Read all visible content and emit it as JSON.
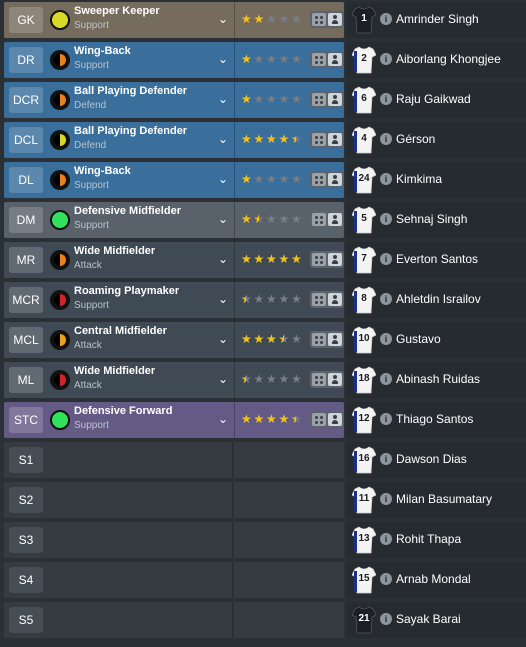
{
  "starters": [
    {
      "pos": "GK",
      "role": "Sweeper Keeper",
      "duty": "Support",
      "style": "gk",
      "duty_colors": [
        "#d6d926",
        "#d6d926"
      ],
      "rating": 2,
      "shirt": "gk",
      "number": "1",
      "player": "Amrinder Singh"
    },
    {
      "pos": "DR",
      "role": "Wing-Back",
      "duty": "Support",
      "style": "def",
      "duty_colors": [
        "#000000",
        "#e8801d"
      ],
      "rating": 1,
      "shirt": "field",
      "number": "2",
      "player": "Aiborlang Khongjee"
    },
    {
      "pos": "DCR",
      "role": "Ball Playing Defender",
      "duty": "Defend",
      "style": "def",
      "duty_colors": [
        "#000000",
        "#e8801d"
      ],
      "rating": 1,
      "shirt": "field",
      "number": "6",
      "player": "Raju Gaikwad"
    },
    {
      "pos": "DCL",
      "role": "Ball Playing Defender",
      "duty": "Defend",
      "style": "def",
      "duty_colors": [
        "#000000",
        "#d6d926"
      ],
      "rating": 4.5,
      "shirt": "field",
      "number": "4",
      "player": "Gérson"
    },
    {
      "pos": "DL",
      "role": "Wing-Back",
      "duty": "Support",
      "style": "def",
      "duty_colors": [
        "#000000",
        "#e8801d"
      ],
      "rating": 1,
      "shirt": "field",
      "number": "24",
      "player": "Kimkima"
    },
    {
      "pos": "DM",
      "role": "Defensive Midfielder",
      "duty": "Support",
      "style": "dm",
      "duty_colors": [
        "#31e25d",
        "#31e25d"
      ],
      "rating": 1.5,
      "shirt": "field",
      "number": "5",
      "player": "Sehnaj Singh"
    },
    {
      "pos": "MR",
      "role": "Wide Midfielder",
      "duty": "Attack",
      "style": "mid",
      "duty_colors": [
        "#000000",
        "#e8801d"
      ],
      "rating": 5,
      "shirt": "field",
      "number": "7",
      "player": "Everton Santos"
    },
    {
      "pos": "MCR",
      "role": "Roaming Playmaker",
      "duty": "Support",
      "style": "mid",
      "duty_colors": [
        "#000000",
        "#d2232a"
      ],
      "rating": 0.5,
      "shirt": "field",
      "number": "8",
      "player": "Ahletdin Israilov"
    },
    {
      "pos": "MCL",
      "role": "Central Midfielder",
      "duty": "Attack",
      "style": "mid",
      "duty_colors": [
        "#000000",
        "#e8a21d"
      ],
      "rating": 3.5,
      "shirt": "field",
      "number": "10",
      "player": "Gustavo"
    },
    {
      "pos": "ML",
      "role": "Wide Midfielder",
      "duty": "Attack",
      "style": "mid",
      "duty_colors": [
        "#000000",
        "#d2232a"
      ],
      "rating": 0.5,
      "shirt": "field",
      "number": "18",
      "player": "Abinash Ruidas"
    },
    {
      "pos": "STC",
      "role": "Defensive Forward",
      "duty": "Support",
      "style": "att",
      "duty_colors": [
        "#31e25d",
        "#31e25d"
      ],
      "rating": 4.5,
      "shirt": "field",
      "number": "12",
      "player": "Thiago Santos"
    }
  ],
  "subs": [
    {
      "pos": "S1",
      "shirt": "field",
      "number": "16",
      "player": "Dawson Dias"
    },
    {
      "pos": "S2",
      "shirt": "field",
      "number": "11",
      "player": "Milan Basumatary"
    },
    {
      "pos": "S3",
      "shirt": "field",
      "number": "13",
      "player": "Rohit Thapa"
    },
    {
      "pos": "S4",
      "shirt": "field",
      "number": "15",
      "player": "Arnab Mondal"
    },
    {
      "pos": "S5",
      "shirt": "gk",
      "number": "21",
      "player": "Sayak Barai"
    }
  ],
  "icons": {
    "dropdown": "chevron-down-icon",
    "info": "info-icon",
    "toggle": "view-toggle-icon",
    "star": "star-icon"
  },
  "colors": {
    "star": "#f2c21b",
    "gk_panel": "#766c5e",
    "defence_panel": "#3a6e9b",
    "dm_panel": "#59616b",
    "midfield_panel": "#3f4a55",
    "attack_panel": "#645a86"
  }
}
